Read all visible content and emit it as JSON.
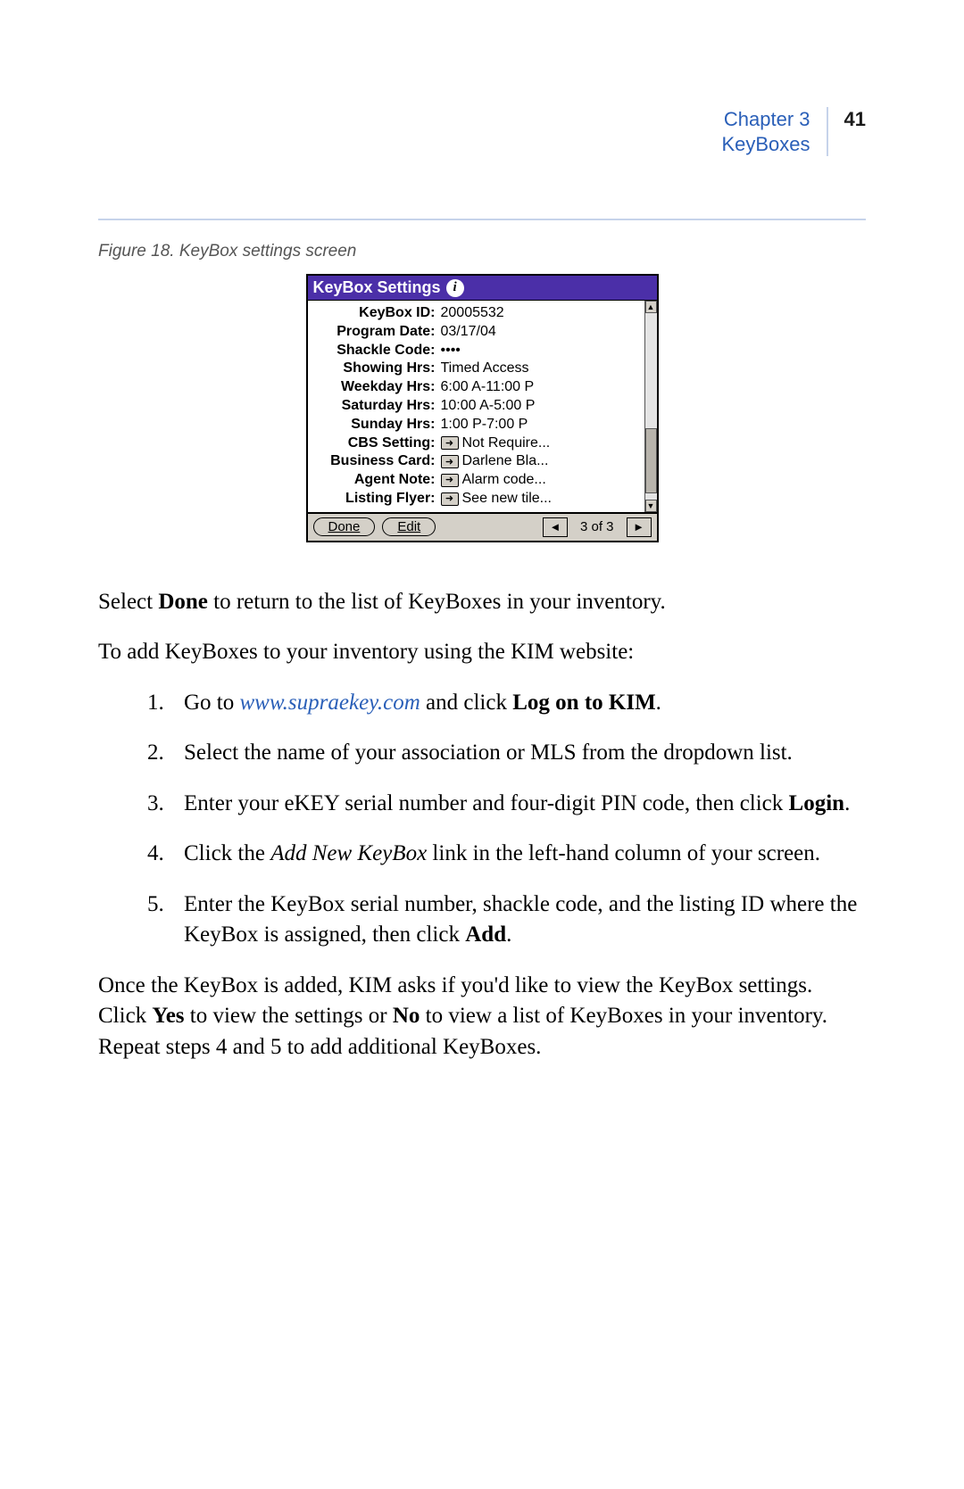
{
  "header": {
    "chapter": "Chapter 3",
    "section": "KeyBoxes",
    "page": "41"
  },
  "figcap": "Figure 18.  KeyBox settings screen",
  "device": {
    "title": "KeyBox Settings",
    "rows": [
      {
        "label": "KeyBox ID:",
        "value": "20005532",
        "icon": false
      },
      {
        "label": "Program Date:",
        "value": "03/17/04",
        "icon": false
      },
      {
        "label": "Shackle Code:",
        "value": "••••",
        "icon": false
      },
      {
        "label": "Showing Hrs:",
        "value": "Timed Access",
        "icon": false
      },
      {
        "label": "Weekday Hrs:",
        "value": "6:00 A-11:00 P",
        "icon": false
      },
      {
        "label": "Saturday Hrs:",
        "value": "10:00 A-5:00 P",
        "icon": false
      },
      {
        "label": "Sunday Hrs:",
        "value": "1:00 P-7:00 P",
        "icon": false
      },
      {
        "label": "CBS Setting:",
        "value": "Not Require...",
        "icon": true
      },
      {
        "label": "Business Card:",
        "value": "Darlene Bla...",
        "icon": true
      },
      {
        "label": "Agent Note:",
        "value": "Alarm code...",
        "icon": true
      },
      {
        "label": "Listing Flyer:",
        "value": "See new tile...",
        "icon": true
      }
    ],
    "footer": {
      "done": "Done",
      "edit": "Edit",
      "count": "3 of 3"
    }
  },
  "text": {
    "p1a": "Select ",
    "p1b": "Done",
    "p1c": " to return to the list of KeyBoxes in your inventory.",
    "p2": "To add KeyBoxes to your inventory using the KIM website:",
    "li1a": "Go to ",
    "li1b": "www.supraekey.com",
    "li1c": " and click ",
    "li1d": "Log on to KIM",
    "li1e": ".",
    "li2": "Select the name of your association or MLS from the dropdown list.",
    "li3a": "Enter your eKEY serial number and four-digit PIN code, then click ",
    "li3b": "Login",
    "li3c": ".",
    "li4a": "Click the ",
    "li4b": "Add New KeyBox",
    "li4c": " link in the left-hand column of your screen.",
    "li5a": "Enter the KeyBox serial number, shackle code, and the listing ID where the KeyBox is assigned, then click ",
    "li5b": "Add",
    "li5c": ".",
    "p3a": "Once the KeyBox is added, KIM asks if you'd like to view the KeyBox settings.  Click ",
    "p3b": "Yes",
    "p3c": " to view the settings or ",
    "p3d": "No",
    "p3e": " to view a list of KeyBoxes in your inventory.  Repeat steps 4 and 5 to add additional KeyBoxes."
  }
}
